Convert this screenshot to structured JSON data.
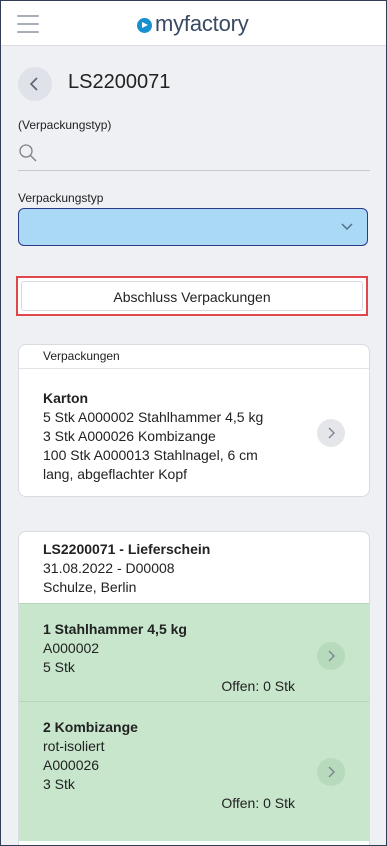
{
  "app": {
    "logo_text": "myfactory"
  },
  "header": {
    "title": "LS2200071"
  },
  "search": {
    "label": "(Verpackungstyp)",
    "value": "",
    "placeholder": ""
  },
  "select": {
    "label": "Verpackungstyp",
    "value": ""
  },
  "actions": {
    "abschluss_label": "Abschluss Verpackungen"
  },
  "packages": {
    "heading": "Verpackungen",
    "items": [
      {
        "name": "Karton",
        "lines": [
          "5 Stk A000002 Stahlhammer 4,5 kg",
          "3 Stk A000026 Kombizange",
          "100 Stk A000013 Stahlnagel, 6 cm",
          "lang, abgeflachter Kopf"
        ]
      }
    ]
  },
  "document": {
    "title": "LS2200071 - Lieferschein",
    "date_line": "31.08.2022 - D00008",
    "customer_line": "Schulze, Berlin",
    "positions": [
      {
        "title": "1 Stahlhammer 4,5 kg",
        "lines": [
          "A000002",
          "5 Stk"
        ],
        "open": "Offen: 0 Stk"
      },
      {
        "title": "2 Kombizange",
        "lines": [
          "rot-isoliert",
          "A000026",
          "3 Stk"
        ],
        "open": "Offen: 0 Stk"
      }
    ]
  },
  "colors": {
    "accent": "#1790d0",
    "select_bg": "#a9d9f5",
    "highlight_border": "#e0474c",
    "position_bg": "#c7e6cc"
  },
  "icons": [
    "hamburger-icon",
    "logo-play-icon",
    "back-arrow-icon",
    "search-icon",
    "chevron-down-icon",
    "chevron-right-icon"
  ]
}
